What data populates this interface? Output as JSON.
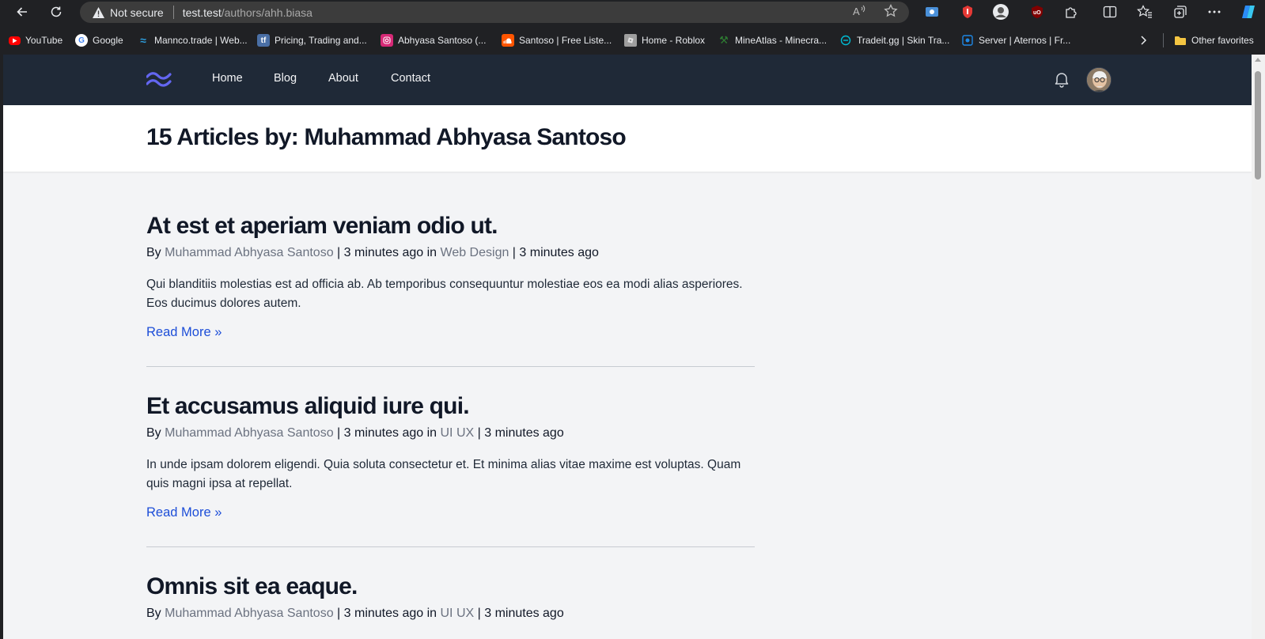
{
  "browser": {
    "security_label": "Not secure",
    "url_host": "test.test",
    "url_path": "/authors/ahh.biasa",
    "toolbar_icons": [
      "back-icon",
      "refresh-icon",
      "read-aloud-icon",
      "favorite-star-icon",
      "screencast-extension-icon",
      "adblock-extension-icon",
      "profile-extension-icon",
      "ublock-extension-icon",
      "extensions-puzzle-icon",
      "split-screen-icon",
      "favorites-icon",
      "collections-icon",
      "more-icon",
      "copilot-icon"
    ]
  },
  "bookmarks": {
    "items": [
      {
        "label": "YouTube",
        "color": "#ff0000"
      },
      {
        "label": "Google",
        "color": "#4285f4"
      },
      {
        "label": "Mannco.trade | Web...",
        "color": "#2d9cdb"
      },
      {
        "label": "Pricing, Trading and...",
        "color": "#4a6fa5"
      },
      {
        "label": "Abhyasa Santoso (...",
        "color": "#d62976"
      },
      {
        "label": "Santoso | Free Liste...",
        "color": "#ff5500"
      },
      {
        "label": "Home - Roblox",
        "color": "#9e9e9e"
      },
      {
        "label": "MineAtlas - Minecra...",
        "color": "#2e7d32"
      },
      {
        "label": "Tradeit.gg | Skin Tra...",
        "color": "#00bcd4"
      },
      {
        "label": "Server | Aternos | Fr...",
        "color": "#1e88e5"
      }
    ],
    "other_favorites": "Other favorites"
  },
  "site": {
    "nav": {
      "home": "Home",
      "blog": "Blog",
      "about": "About",
      "contact": "Contact"
    },
    "page_title": "15 Articles by: Muhammad Abhyasa Santoso",
    "posts": [
      {
        "title": "At est et aperiam veniam odio ut.",
        "by": "By ",
        "author": "Muhammad Abhyasa Santoso",
        "sep1": " | 3 minutes ago in ",
        "category": "Web Design",
        "sep2": " | 3 minutes ago",
        "excerpt": "Qui blanditiis molestias est ad officia ab. Ab temporibus consequuntur molestiae eos ea modi alias asperiores. Eos ducimus dolores autem.",
        "read_more": "Read More »"
      },
      {
        "title": "Et accusamus aliquid iure qui.",
        "by": "By ",
        "author": "Muhammad Abhyasa Santoso",
        "sep1": " | 3 minutes ago in ",
        "category": "UI UX",
        "sep2": " | 3 minutes ago",
        "excerpt": "In unde ipsam dolorem eligendi. Quia soluta consectetur et. Et minima alias vitae maxime est voluptas. Quam quis magni ipsa at repellat.",
        "read_more": "Read More »"
      },
      {
        "title": "Omnis sit ea eaque.",
        "by": "By ",
        "author": "Muhammad Abhyasa Santoso",
        "sep1": " | 3 minutes ago in ",
        "category": "UI UX",
        "sep2": " | 3 minutes ago"
      }
    ]
  },
  "colors": {
    "nav_bg": "#1f2937",
    "page_bg": "#f3f4f6",
    "link_blue": "#1d4ed8",
    "logo_indigo": "#6366f1"
  }
}
